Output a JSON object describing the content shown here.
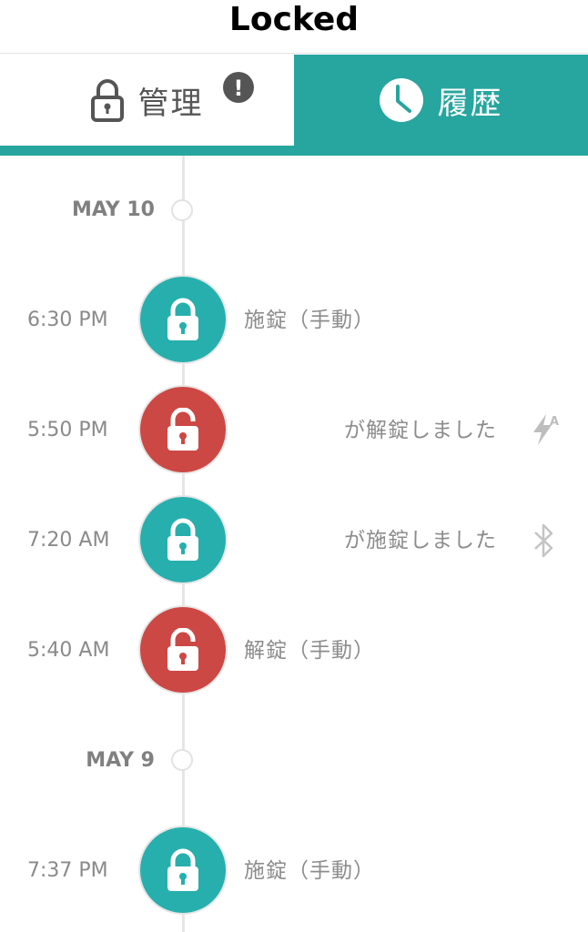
{
  "header": {
    "title": "Locked"
  },
  "tabs": {
    "manage": {
      "label": "管理",
      "badge": "!",
      "active": false
    },
    "history": {
      "label": "履歴",
      "active": true
    }
  },
  "colors": {
    "accent": "#27a59f",
    "locked": "#27afad",
    "unlocked": "#cc4844",
    "muted_text": "#8a8a8a"
  },
  "timeline": {
    "dates": [
      {
        "label": "MAY 10"
      },
      {
        "label": "MAY 9"
      }
    ],
    "events": [
      {
        "time": "6:30 PM",
        "state": "locked",
        "text": "施錠（手動）",
        "text_align": "left",
        "method_icon": ""
      },
      {
        "time": "5:50 PM",
        "state": "unlocked",
        "text": "が解錠しました",
        "text_align": "right",
        "method_icon": "auto-unlock-icon"
      },
      {
        "time": "7:20 AM",
        "state": "locked",
        "text": "が施錠しました",
        "text_align": "right",
        "method_icon": "bluetooth-icon"
      },
      {
        "time": "5:40 AM",
        "state": "unlocked",
        "text": "解錠（手動）",
        "text_align": "left",
        "method_icon": ""
      },
      {
        "time": "7:37 PM",
        "state": "locked",
        "text": "施錠（手動）",
        "text_align": "left",
        "method_icon": ""
      }
    ]
  }
}
